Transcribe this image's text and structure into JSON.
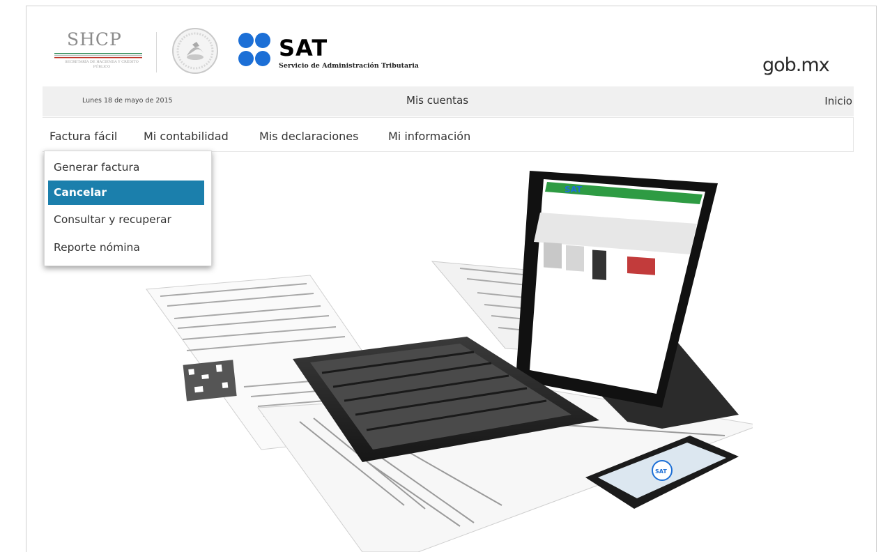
{
  "header": {
    "shcp_logo_title": "SHCP",
    "shcp_logo_subtitle": "SECRETARÍA DE HACIENDA Y CRÉDITO PÚBLICO",
    "sat_logo_title": "SAT",
    "sat_logo_subtitle": "Servicio de Administración Tributaria",
    "gob_logo": "gob.mx"
  },
  "topbar": {
    "date": "Lunes 18 de mayo de 2015",
    "title": "Mis cuentas",
    "home_link": "Inicio"
  },
  "nav": {
    "items": [
      {
        "label": "Factura fácil"
      },
      {
        "label": "Mi contabilidad"
      },
      {
        "label": "Mis declaraciones"
      },
      {
        "label": "Mi información"
      }
    ]
  },
  "dropdown": {
    "items": [
      {
        "label": "Generar factura"
      },
      {
        "label": "Cancelar",
        "active": true
      },
      {
        "label": "Consultar y recuperar"
      },
      {
        "label": "Reporte nómina"
      }
    ]
  },
  "colors": {
    "accent": "#1b7fac",
    "sat_blue": "#1c6fd6",
    "topbar_bg": "#f0f0f0"
  },
  "hero": {
    "device_screen_logo": "SAT",
    "phone_screen_logo": "SAT"
  }
}
